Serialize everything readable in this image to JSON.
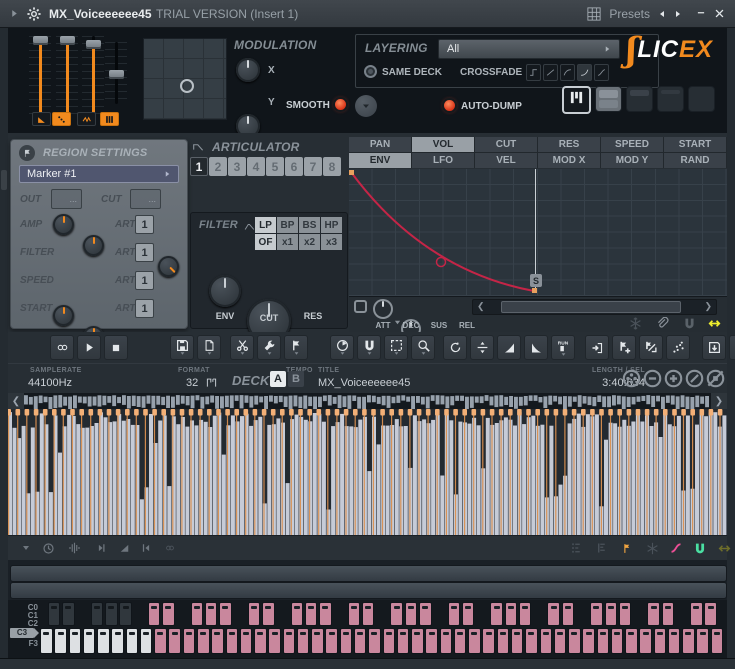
{
  "colors": {
    "accent_orange": "#F28A1E",
    "led_red": "#E8432A",
    "curve_red": "#C42547",
    "slice_marker": "#E8A05E",
    "slice_flag": "#F3B077",
    "key_pink": "#C9879D",
    "magnet_green": "#4ADFA2",
    "slide_pink": "#ED4F96",
    "flag_orange": "#F0A440",
    "arrows_yellow": "#EDED2E",
    "wave_light": "#C6CBD7"
  },
  "titlebar": {
    "title": "MX_Voiceeeeee45",
    "trial": "TRIAL VERSION (Insert 1)",
    "presets_label": "Presets"
  },
  "deck_panel": {
    "modulation": {
      "title": "MODULATION",
      "x_label": "X",
      "y_label": "Y",
      "smooth_label": "SMOOTH"
    },
    "layering": {
      "title": "LAYERING",
      "layer_value": "All",
      "same_deck_label": "SAME DECK",
      "crossfade_label": "CROSSFADE"
    },
    "auto_dump_label": "AUTO-DUMP",
    "logo": {
      "lic": "LIC",
      "ex": "EX"
    }
  },
  "region": {
    "title": "REGION SETTINGS",
    "marker_value": "Marker #1",
    "out_label": "OUT",
    "cut_label": "CUT",
    "box_placeholder": "...",
    "art_label": "ART",
    "art_value": "1",
    "rows": [
      "AMP",
      "FILTER",
      "SPEED",
      "START"
    ]
  },
  "articulator": {
    "title": "ARTICULATOR",
    "slots": [
      "1",
      "2",
      "3",
      "4",
      "5",
      "6",
      "7",
      "8"
    ],
    "selected_slot": "1"
  },
  "filter": {
    "title": "FILTER",
    "grid": [
      [
        "LP",
        "BP",
        "BS",
        "HP"
      ],
      [
        "OF",
        "x1",
        "x2",
        "x3"
      ]
    ],
    "selected": [
      "LP",
      "OF"
    ],
    "knob_labels": [
      "ENV",
      "CUT",
      "RES"
    ]
  },
  "envelope": {
    "tabs": [
      [
        "PAN",
        "VOL",
        "CUT",
        "RES",
        "SPEED",
        "START"
      ],
      [
        "ENV",
        "LFO",
        "VEL",
        "MOD X",
        "MOD Y",
        "RAND"
      ]
    ],
    "selected_tabs": [
      "VOL",
      "ENV"
    ],
    "adsr_labels": [
      "ATT",
      "DEC",
      "SUS",
      "REL"
    ],
    "tempo_label": "TEMPO",
    "sustain_badge": "S"
  },
  "toolbar": {
    "groups": [
      {
        "icons": [
          {
            "name": "loop"
          },
          {
            "name": "play"
          },
          {
            "name": "stop"
          }
        ]
      },
      {
        "icons": [
          {
            "name": "save",
            "dropdown": true
          },
          {
            "name": "new-page",
            "dropdown": true
          }
        ]
      },
      {
        "icons": [
          {
            "name": "cut",
            "dropdown": true
          },
          {
            "name": "wrench",
            "dropdown": true
          },
          {
            "name": "marker",
            "dropdown": true
          }
        ]
      },
      {
        "icons": [
          {
            "name": "preview-clock",
            "dropdown": true
          },
          {
            "name": "magnet",
            "dropdown": true
          },
          {
            "name": "select",
            "dropdown": true
          },
          {
            "name": "zoom",
            "dropdown": true
          }
        ]
      },
      {
        "icons": [
          {
            "name": "normalize"
          },
          {
            "name": "center"
          },
          {
            "name": "fade-in"
          },
          {
            "name": "fade-out"
          },
          {
            "name": "run",
            "dropdown": true
          }
        ]
      },
      {
        "icons": [
          {
            "name": "slide-door"
          },
          {
            "name": "marker-add"
          },
          {
            "name": "marker-drag"
          },
          {
            "name": "declick"
          }
        ]
      },
      {
        "icons": [
          {
            "name": "save-sample"
          },
          {
            "name": "export-list"
          }
        ]
      }
    ]
  },
  "infobar": {
    "samplerate_label": "SAMPLERATE",
    "samplerate_value": "44100Hz",
    "format_label": "FORMAT",
    "format_value": "32",
    "tempo_label": "TEMPO",
    "tempo_value": "-",
    "deck_label": "DECK",
    "deck_a": "A",
    "deck_b": "B",
    "title_label": "TITLE",
    "title_value": "MX_Voiceeeeee45",
    "length_label": "LENGTH / SEL",
    "length_value": "3:40:634",
    "circle_icons": [
      "pan-circle",
      "zoom-out-circle",
      "zoom-in-circle",
      "slash-circle",
      "mute-circle"
    ]
  },
  "wave": {
    "slice_count": 79,
    "column_count": 158
  },
  "wavebar": {
    "left_icons": [
      "dropdown-tri",
      "spin-clock",
      "stretch",
      "next-marker",
      "ramp",
      "prev-marker",
      "link"
    ],
    "right_icons": [
      "list-flags",
      "list-flags2",
      "flag-small",
      "freeze",
      "s-curve",
      "magnet-green",
      "arrows-h"
    ]
  },
  "keyboard": {
    "labels": [
      "C0",
      "C1",
      "C2",
      "C3",
      "F3"
    ],
    "selected_label": "C3",
    "white_key_count": 48,
    "unmapped_white": 8,
    "unmapped_black": 5
  }
}
